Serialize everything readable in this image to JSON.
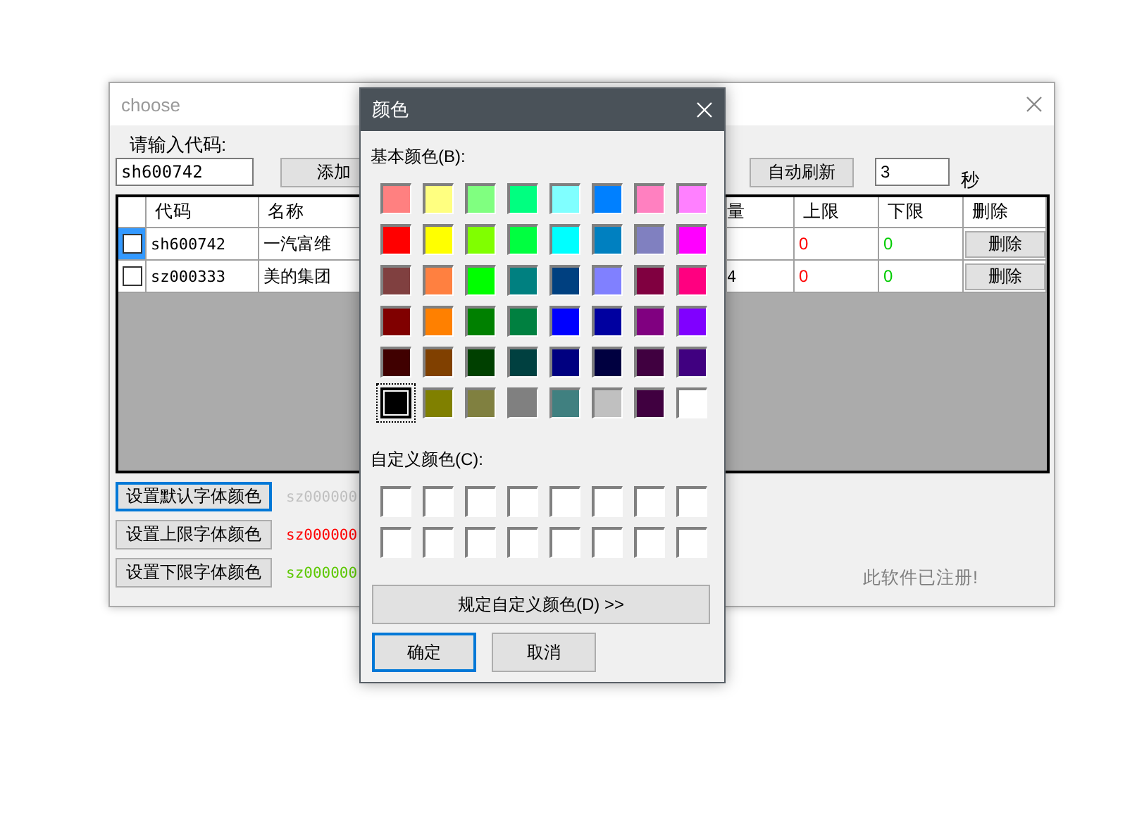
{
  "main_window": {
    "title": "choose",
    "code_label": "请输入代码:",
    "code_input": {
      "value": "sh600742"
    },
    "add_button": "添加",
    "auto_refresh_button": "自动刷新",
    "interval_input": {
      "value": "3"
    },
    "interval_unit": "秒",
    "table": {
      "columns": [
        "代码",
        "名称",
        "量",
        "上限",
        "下限",
        "删除"
      ],
      "rows": [
        {
          "selected": true,
          "checked": false,
          "code": "sh600742",
          "name": "一汽富维",
          "upper": "0",
          "lower": "0",
          "action": "删除"
        },
        {
          "selected": false,
          "checked": false,
          "code": "sz000333",
          "name": "美的集团",
          "column_4": "4",
          "upper": "0",
          "lower": "0",
          "action": "删除"
        }
      ]
    },
    "color_buttons": [
      {
        "label": "设置默认字体颜色",
        "sample": "sz000000",
        "color": "#c0c0c0",
        "focused": true
      },
      {
        "label": "设置上限字体颜色",
        "sample": "sz000000",
        "color": "#ff0000",
        "focused": false
      },
      {
        "label": "设置下限字体颜色",
        "sample": "sz000000",
        "color": "#5cc800",
        "focused": false
      }
    ],
    "status": "此软件已注册!"
  },
  "color_dialog": {
    "title": "颜色",
    "basic_label": "基本颜色(B):",
    "basic_colors": [
      {
        "color": "#ff8080",
        "selected": false
      },
      {
        "color": "#ffff80",
        "selected": false
      },
      {
        "color": "#80ff80",
        "selected": false
      },
      {
        "color": "#00ff80",
        "selected": false
      },
      {
        "color": "#80ffff",
        "selected": false
      },
      {
        "color": "#0080ff",
        "selected": false
      },
      {
        "color": "#ff80c0",
        "selected": false
      },
      {
        "color": "#ff80ff",
        "selected": false
      },
      {
        "color": "#ff0000",
        "selected": false
      },
      {
        "color": "#ffff00",
        "selected": false
      },
      {
        "color": "#80ff00",
        "selected": false
      },
      {
        "color": "#00ff40",
        "selected": false
      },
      {
        "color": "#00ffff",
        "selected": false
      },
      {
        "color": "#0080c0",
        "selected": false
      },
      {
        "color": "#8080c0",
        "selected": false
      },
      {
        "color": "#ff00ff",
        "selected": false
      },
      {
        "color": "#804040",
        "selected": false
      },
      {
        "color": "#ff8040",
        "selected": false
      },
      {
        "color": "#00ff00",
        "selected": false
      },
      {
        "color": "#008080",
        "selected": false
      },
      {
        "color": "#004080",
        "selected": false
      },
      {
        "color": "#8080ff",
        "selected": false
      },
      {
        "color": "#800040",
        "selected": false
      },
      {
        "color": "#ff0080",
        "selected": false
      },
      {
        "color": "#800000",
        "selected": false
      },
      {
        "color": "#ff8000",
        "selected": false
      },
      {
        "color": "#008000",
        "selected": false
      },
      {
        "color": "#008040",
        "selected": false
      },
      {
        "color": "#0000ff",
        "selected": false
      },
      {
        "color": "#0000a0",
        "selected": false
      },
      {
        "color": "#800080",
        "selected": false
      },
      {
        "color": "#8000ff",
        "selected": false
      },
      {
        "color": "#400000",
        "selected": false
      },
      {
        "color": "#804000",
        "selected": false
      },
      {
        "color": "#004000",
        "selected": false
      },
      {
        "color": "#004040",
        "selected": false
      },
      {
        "color": "#000080",
        "selected": false
      },
      {
        "color": "#000040",
        "selected": false
      },
      {
        "color": "#400040",
        "selected": false
      },
      {
        "color": "#400080",
        "selected": false
      },
      {
        "color": "#000000",
        "selected": true
      },
      {
        "color": "#808000",
        "selected": false
      },
      {
        "color": "#808040",
        "selected": false
      },
      {
        "color": "#808080",
        "selected": false
      },
      {
        "color": "#408080",
        "selected": false
      },
      {
        "color": "#c0c0c0",
        "selected": false
      },
      {
        "color": "#400040",
        "selected": false
      },
      {
        "color": "#ffffff",
        "selected": false
      }
    ],
    "custom_label": "自定义颜色(C):",
    "custom_colors": [
      {
        "color": "#ffffff"
      },
      {
        "color": "#ffffff"
      },
      {
        "color": "#ffffff"
      },
      {
        "color": "#ffffff"
      },
      {
        "color": "#ffffff"
      },
      {
        "color": "#ffffff"
      },
      {
        "color": "#ffffff"
      },
      {
        "color": "#ffffff"
      },
      {
        "color": "#ffffff"
      },
      {
        "color": "#ffffff"
      },
      {
        "color": "#ffffff"
      },
      {
        "color": "#ffffff"
      },
      {
        "color": "#ffffff"
      },
      {
        "color": "#ffffff"
      },
      {
        "color": "#ffffff"
      },
      {
        "color": "#ffffff"
      }
    ],
    "define_button": "规定自定义颜色(D) >>",
    "buttons": [
      {
        "label": "确定",
        "focused": true
      },
      {
        "label": "取消",
        "focused": false
      }
    ]
  }
}
